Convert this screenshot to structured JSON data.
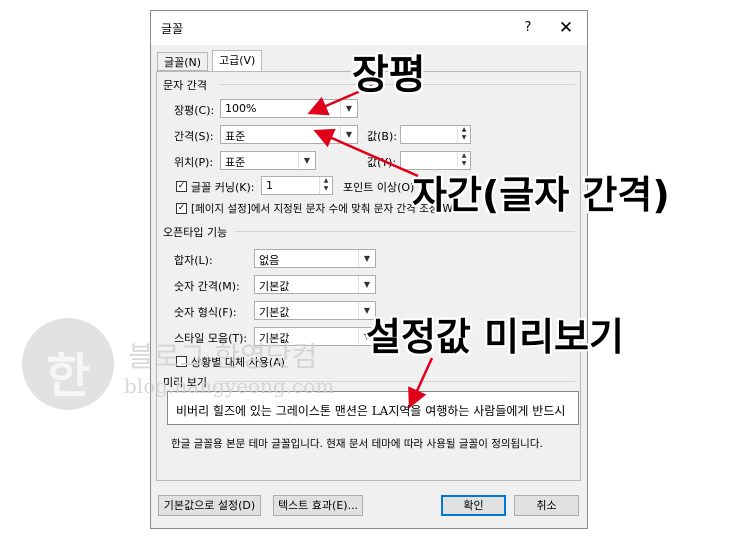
{
  "dialog": {
    "title": "글꼴",
    "help_label": "?",
    "close_label": "✕",
    "tabs": [
      {
        "label": "글꼴(N)",
        "active": false
      },
      {
        "label": "고급(V)",
        "active": true
      }
    ]
  },
  "char_spacing": {
    "section_title": "문자 간격",
    "scale_label": "장평(C):",
    "scale_value": "100%",
    "spacing_label": "간격(S):",
    "spacing_value": "표준",
    "spacing_by_label": "값(B):",
    "position_label": "위치(P):",
    "position_value": "표준",
    "position_by_label": "값(Y):",
    "kerning_label": "글꼴 커닝(K):",
    "kerning_checked": true,
    "kerning_value": "1",
    "kerning_unit": "포인트 이상(O)",
    "snap_label": "[페이지 설정]에서 지정된 문자 수에 맞춰 문자 간격 조정(W)",
    "snap_checked": true
  },
  "opentype": {
    "section_title": "오픈타입 기능",
    "ligatures_label": "합자(L):",
    "ligatures_value": "없음",
    "number_spacing_label": "숫자 간격(M):",
    "number_spacing_value": "기본값",
    "number_forms_label": "숫자 형식(F):",
    "number_forms_value": "기본값",
    "stylistic_sets_label": "스타일 모음(T):",
    "stylistic_sets_value": "기본값",
    "contextual_label": "상황별 대체 사용(A)",
    "contextual_checked": false
  },
  "preview": {
    "section_title": "미리 보기",
    "sample_text": "비버리 힐즈에 있는 그레이스톤 맨션은 LA지역을 여행하는 사람들에게 반드시",
    "description": "한글 글꼴용 본문 테마 글꼴입니다. 현재 문서 테마에 따라 사용될 글꼴이 정의됩니다."
  },
  "footer": {
    "set_default_label": "기본값으로 설정(D)",
    "text_effects_label": "텍스트 효과(E)...",
    "ok_label": "확인",
    "cancel_label": "취소"
  },
  "annotations": {
    "scale": "장평",
    "spacing": "자간(글자 간격)",
    "preview": "설정값 미리보기"
  },
  "watermark": {
    "logo_char": "한",
    "name": "블로그 한영닷컴",
    "url": "blog.hangyeong.com"
  },
  "colors": {
    "arrow": "#e0001a",
    "dialog_bg": "#f0f0f0",
    "accent": "#0078d7"
  }
}
